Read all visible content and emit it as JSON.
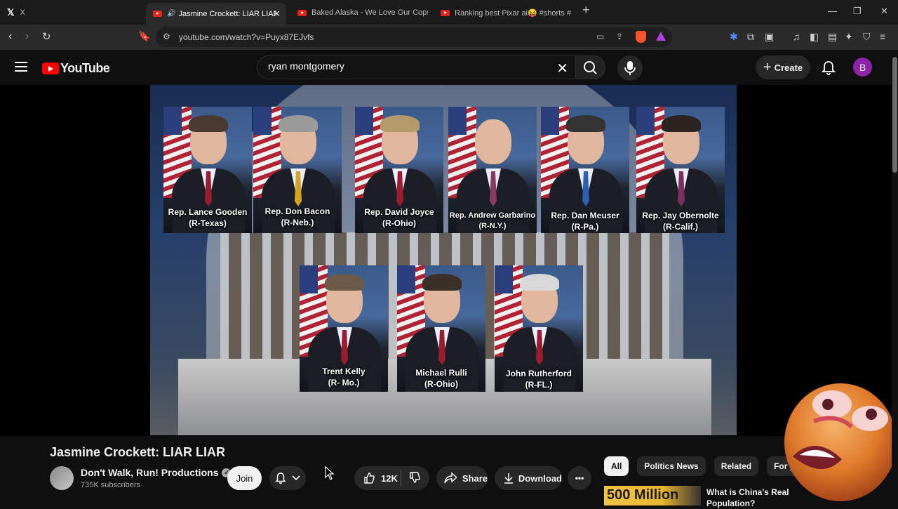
{
  "browser": {
    "tabs": [
      {
        "label": "X"
      },
      {
        "label": "Jasmine Crockett: LIAR LIAR -"
      },
      {
        "label": "Baked Alaska - We Love Our Cops [L"
      },
      {
        "label": "Ranking best Pixar ai😝 #shorts #pix"
      }
    ],
    "url": "youtube.com/watch?v=Puyx87EJvfs"
  },
  "youtube": {
    "logo_text": "YouTube",
    "search_value": "ryan montgomery",
    "create_label": "Create",
    "avatar_initial": "B"
  },
  "video": {
    "title": "Jasmine Crockett: LIAR LIAR",
    "representatives_top": [
      {
        "name": "Rep. Lance Gooden",
        "party": "(R-Texas)"
      },
      {
        "name": "Rep. Don Bacon",
        "party": "(R-Neb.)"
      },
      {
        "name": "Rep. David Joyce",
        "party": "(R-Ohio)"
      },
      {
        "name": "Rep. Andrew Garbarino",
        "party": "(R-N.Y.)"
      },
      {
        "name": "Rep. Dan Meuser",
        "party": "(R-Pa.)"
      },
      {
        "name": "Rep. Jay Obernolte",
        "party": "(R-Calif.)"
      }
    ],
    "representatives_bottom": [
      {
        "name": "Trent Kelly",
        "party": "(R- Mo.)"
      },
      {
        "name": "Michael Rulli",
        "party": "(R-Ohio)"
      },
      {
        "name": "John Rutherford",
        "party": "(R-FL.)"
      }
    ]
  },
  "channel": {
    "name": "Don't Walk, Run! Productions",
    "verified_icon": "checkmark-badge-icon",
    "subscribers": "735K subscribers",
    "join_label": "Join"
  },
  "actions": {
    "likes": "12K",
    "share_label": "Share",
    "download_label": "Download",
    "more_label": "•••"
  },
  "sidebar": {
    "chips": [
      "All",
      "Politics News",
      "Related",
      "For y"
    ],
    "related": [
      {
        "thumb_text": "500 Million",
        "title": "What is China's Real Population?"
      }
    ]
  },
  "colors": {
    "background": "#0f0f0f",
    "brand_red": "#ff0000",
    "avatar": "#8e24aa"
  }
}
